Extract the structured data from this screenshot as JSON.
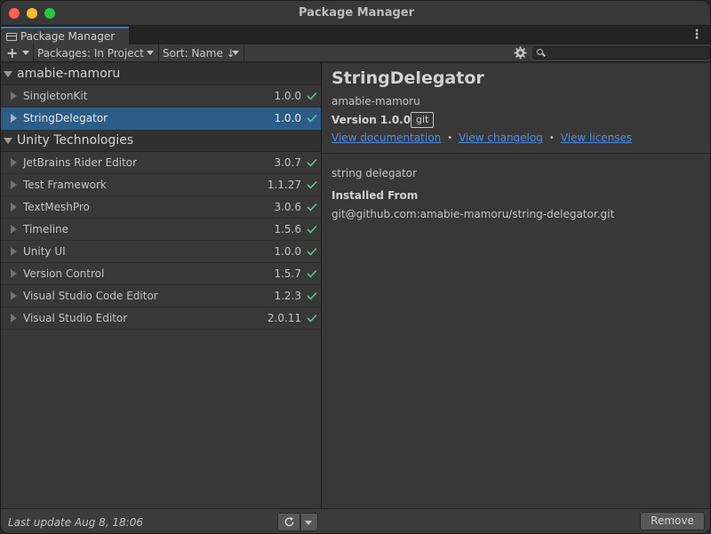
{
  "window": {
    "title": "Package Manager"
  },
  "tab": {
    "label": "Package Manager"
  },
  "toolbar": {
    "add_label": "+",
    "packages_filter": "Packages: In Project",
    "sort": "Sort: Name ↓",
    "search_placeholder": ""
  },
  "groups": [
    {
      "name": "amabie-mamoru",
      "packages": [
        {
          "name": "SingletonKit",
          "version": "1.0.0",
          "installed": true,
          "selected": false
        },
        {
          "name": "StringDelegator",
          "version": "1.0.0",
          "installed": true,
          "selected": true
        }
      ]
    },
    {
      "name": "Unity Technologies",
      "packages": [
        {
          "name": "JetBrains Rider Editor",
          "version": "3.0.7",
          "installed": true,
          "selected": false
        },
        {
          "name": "Test Framework",
          "version": "1.1.27",
          "installed": true,
          "selected": false
        },
        {
          "name": "TextMeshPro",
          "version": "3.0.6",
          "installed": true,
          "selected": false
        },
        {
          "name": "Timeline",
          "version": "1.5.6",
          "installed": true,
          "selected": false
        },
        {
          "name": "Unity UI",
          "version": "1.0.0",
          "installed": true,
          "selected": false
        },
        {
          "name": "Version Control",
          "version": "1.5.7",
          "installed": true,
          "selected": false
        },
        {
          "name": "Visual Studio Code Editor",
          "version": "1.2.3",
          "installed": true,
          "selected": false
        },
        {
          "name": "Visual Studio Editor",
          "version": "2.0.11",
          "installed": true,
          "selected": false
        }
      ]
    }
  ],
  "detail": {
    "title": "StringDelegator",
    "author": "amabie-mamoru",
    "version_label": "Version 1.0.0",
    "tag": "git",
    "links": [
      "View documentation",
      "View changelog",
      "View licenses"
    ],
    "description": "string delegator",
    "installed_from_label": "Installed From",
    "installed_from_value": "git@github.com:amabie-mamoru/string-delegator.git"
  },
  "footer": {
    "last_update": "Last update Aug 8, 18:06",
    "remove_label": "Remove"
  },
  "colors": {
    "selection": "#2c5d87",
    "link": "#4c8ee8",
    "check": "#5fc18f",
    "tab_accent": "#3a79bb"
  },
  "icons": {
    "refresh": "refresh-icon",
    "settings": "gear-icon",
    "search": "search-icon",
    "installed": "check-icon",
    "more": "kebab-menu-icon"
  }
}
